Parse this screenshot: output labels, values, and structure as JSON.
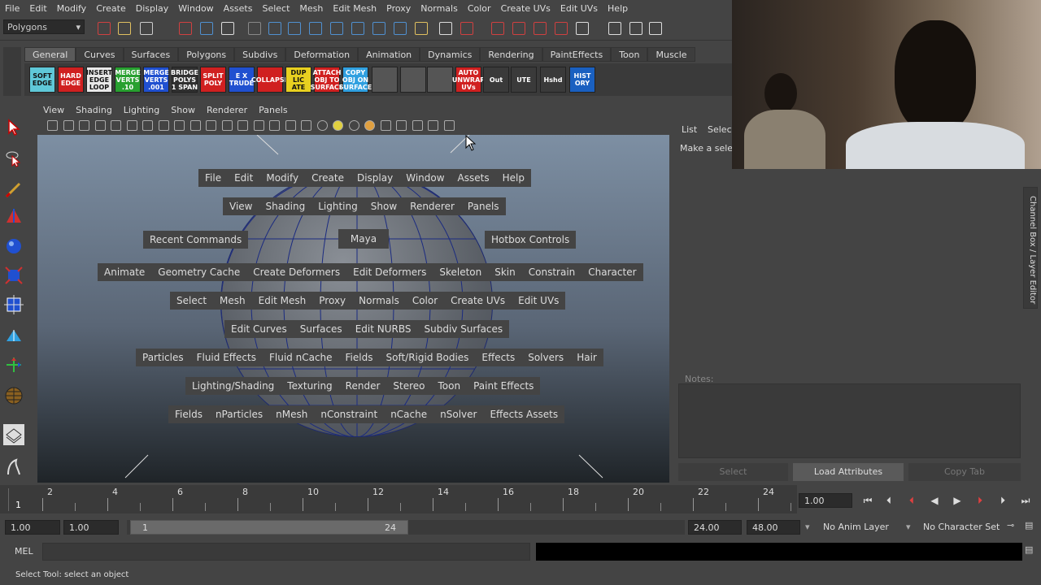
{
  "menubar": [
    "File",
    "Edit",
    "Modify",
    "Create",
    "Display",
    "Window",
    "Assets",
    "Select",
    "Mesh",
    "Edit Mesh",
    "Proxy",
    "Normals",
    "Color",
    "Create UVs",
    "Edit UVs",
    "Help"
  ],
  "mode_selector": "Polygons",
  "shelf_tabs": [
    "General",
    "Curves",
    "Surfaces",
    "Polygons",
    "Subdivs",
    "Deformation",
    "Animation",
    "Dynamics",
    "Rendering",
    "PaintEffects",
    "Toon",
    "Muscle"
  ],
  "shelf_active": "General",
  "shelf_buttons": [
    {
      "label": "SOFT EDGE",
      "bg": "#5fc8d8",
      "fg": "#111"
    },
    {
      "label": "HARD EDGE",
      "bg": "#d02020",
      "fg": "#fff"
    },
    {
      "label": "INSERT EDGE LOOP",
      "bg": "#e8e8e8",
      "fg": "#111"
    },
    {
      "label": "MERGE VERTS .10",
      "bg": "#28a030",
      "fg": "#fff"
    },
    {
      "label": "MERGE VERTS .001",
      "bg": "#2050d0",
      "fg": "#fff"
    },
    {
      "label": "BRIDGE POLYS 1 SPAN",
      "bg": "#303030",
      "fg": "#fff"
    },
    {
      "label": "SPLIT POLY",
      "bg": "#d02020",
      "fg": "#fff"
    },
    {
      "label": "E X TRUDE",
      "bg": "#2050d0",
      "fg": "#fff"
    },
    {
      "label": "COLLAPSE",
      "bg": "#d02020",
      "fg": "#fff"
    },
    {
      "label": "DUP LIC ATE",
      "bg": "#e8d020",
      "fg": "#111"
    },
    {
      "label": "ATTACH OBJ TO SURFACE",
      "bg": "#d02020",
      "fg": "#fff"
    },
    {
      "label": "COPY OBJ ON SURFACE",
      "bg": "#30a0e0",
      "fg": "#fff"
    },
    {
      "label": "",
      "bg": "#555",
      "fg": "#fff"
    },
    {
      "label": "",
      "bg": "#555",
      "fg": "#fff"
    },
    {
      "label": "",
      "bg": "#555",
      "fg": "#fff"
    },
    {
      "label": "AUTO UNWRAP UVs",
      "bg": "#d02020",
      "fg": "#fff"
    },
    {
      "label": "Out",
      "bg": "#3a3a3a",
      "fg": "#fff"
    },
    {
      "label": "UTE",
      "bg": "#3a3a3a",
      "fg": "#fff"
    },
    {
      "label": "Hshd",
      "bg": "#3a3a3a",
      "fg": "#fff"
    },
    {
      "label": "HIST ORY",
      "bg": "#1a60c0",
      "fg": "#fff"
    }
  ],
  "viewport_menu": [
    "View",
    "Shading",
    "Lighting",
    "Show",
    "Renderer",
    "Panels"
  ],
  "hotbox": {
    "row1": [
      "File",
      "Edit",
      "Modify",
      "Create",
      "Display",
      "Window",
      "Assets",
      "Help"
    ],
    "row2": [
      "View",
      "Shading",
      "Lighting",
      "Show",
      "Renderer",
      "Panels"
    ],
    "recent": "Recent Commands",
    "center": "Maya",
    "hotbox_controls": "Hotbox Controls",
    "row3": [
      "Animate",
      "Geometry Cache",
      "Create Deformers",
      "Edit Deformers",
      "Skeleton",
      "Skin",
      "Constrain",
      "Character"
    ],
    "row4": [
      "Select",
      "Mesh",
      "Edit Mesh",
      "Proxy",
      "Normals",
      "Color",
      "Create UVs",
      "Edit UVs"
    ],
    "row5": [
      "Edit Curves",
      "Surfaces",
      "Edit NURBS",
      "Subdiv Surfaces"
    ],
    "row6": [
      "Particles",
      "Fluid Effects",
      "Fluid nCache",
      "Fields",
      "Soft/Rigid Bodies",
      "Effects",
      "Solvers",
      "Hair"
    ],
    "row7": [
      "Lighting/Shading",
      "Texturing",
      "Render",
      "Stereo",
      "Toon",
      "Paint Effects"
    ],
    "row8": [
      "Fields",
      "nParticles",
      "nMesh",
      "nConstraint",
      "nCache",
      "nSolver",
      "Effects Assets"
    ]
  },
  "channel_box": {
    "menu": [
      "List",
      "Select"
    ],
    "message": "Make a selec",
    "side_tab": "Channel Box / Layer Editor"
  },
  "attribute_editor": {
    "notes_label": "Notes:",
    "buttons": [
      "Select",
      "Load Attributes",
      "Copy Tab"
    ]
  },
  "timeline": {
    "ticks": [
      "2",
      "4",
      "6",
      "8",
      "10",
      "12",
      "14",
      "16",
      "18",
      "20",
      "22",
      "24"
    ],
    "current_frame_marker": "1",
    "current_time": "1.00"
  },
  "range": {
    "start": "1.00",
    "playback_start": "1.00",
    "slider_start": "1",
    "slider_end": "24",
    "playback_end": "24.00",
    "end": "48.00",
    "anim_layer": "No Anim Layer",
    "character_set": "No Character Set"
  },
  "mel_label": "MEL",
  "help_line": "Select Tool: select an object"
}
